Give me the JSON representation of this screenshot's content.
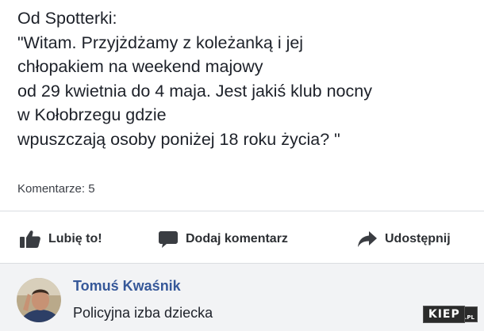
{
  "post": {
    "lines": [
      "Od Spotterki:",
      "\"Witam. Przyjżdżamy z koleżanką i jej",
      "chłopakiem na weekend majowy",
      "od 29 kwietnia do 4 maja. Jest jakiś klub nocny",
      "w Kołobrzegu gdzie",
      "wpuszczają osoby poniżej 18 roku życia? \""
    ],
    "comment_count": "Komentarze: 5"
  },
  "actions": {
    "like_label": "Lubię to!",
    "comment_label": "Dodaj komentarz",
    "share_label": "Udostępnij",
    "like_icon": "thumbs-up-icon",
    "comment_icon": "speech-bubble-icon",
    "share_icon": "share-arrow-icon"
  },
  "comment": {
    "author": "Tomuś Kwaśnik",
    "text": "Policyjna izba dziecka"
  },
  "watermark": {
    "main": "KIEP",
    "sub": ".PL"
  },
  "colors": {
    "author": "#365899",
    "comment_bg": "#f2f3f5"
  }
}
